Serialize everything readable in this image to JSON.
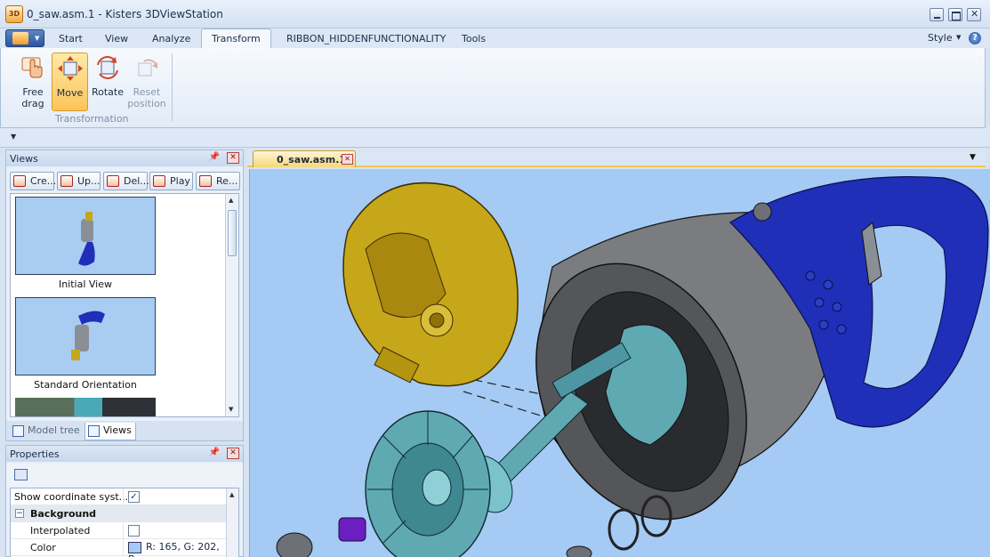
{
  "window": {
    "title": "0_saw.asm.1 - Kisters 3DViewStation",
    "app_icon_text": "3D"
  },
  "ribbon": {
    "tabs": [
      "Start",
      "View",
      "Analyze",
      "Transform",
      "RIBBON_HIDDENFUNCTIONALITY",
      "Tools"
    ],
    "active_tab": "Transform",
    "style_label": "Style",
    "buttons": {
      "free_drag": [
        "Free",
        "drag"
      ],
      "move": "Move",
      "rotate": "Rotate",
      "reset_position": [
        "Reset",
        "position"
      ]
    },
    "group_label": "Transformation"
  },
  "views_panel": {
    "title": "Views",
    "buttons": [
      "Cre...",
      "Up...",
      "Del...",
      "Play",
      "Re..."
    ],
    "items": [
      {
        "label": "Initial View"
      },
      {
        "label": "Standard Orientation"
      }
    ],
    "tabs": [
      "Model tree",
      "Views"
    ],
    "active_tab": "Views"
  },
  "properties_panel": {
    "title": "Properties",
    "rows": [
      {
        "name": "Show coordinate syst...",
        "checked": true
      },
      {
        "group": "Background"
      },
      {
        "name": "Interpolated",
        "checked": false
      },
      {
        "name": "Color",
        "value": "R: 165, G: 202, B: ..."
      }
    ]
  },
  "document": {
    "tab_label": "0_saw.asm.1"
  },
  "colors": {
    "viewport_background": "#a5caf4",
    "accent_active": "#fcc45a",
    "model_blue": "#1f2fb8",
    "model_gold": "#c7a71a",
    "model_teal": "#5fa9b3"
  }
}
